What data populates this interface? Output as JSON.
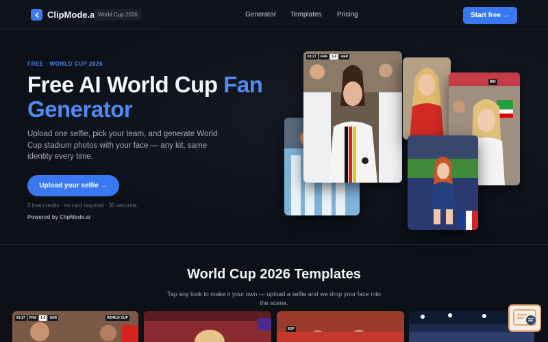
{
  "nav": {
    "brand": "ClipMode.ai",
    "badge": "World Cup 2026",
    "links": [
      "Generator",
      "Templates",
      "Pricing"
    ],
    "cta": "Start free →"
  },
  "hero": {
    "eyebrow": "FREE · WORLD CUP 2026",
    "title_part1": "Free AI World Cup ",
    "title_accent1": "Fan",
    "title_accent2": "Generator",
    "description": "Upload one selfie, pick your team, and generate World Cup stadium photos with your face — any kit, same identity every time.",
    "cta": "Upload your selfie →",
    "note": "3 free credits · no card required · 30 seconds",
    "powered": "Powered by ClipMode.ai"
  },
  "scoreboards": {
    "main": {
      "time": "63:27",
      "home": "FRA",
      "score": "1-0",
      "away": "GER"
    },
    "iran": {
      "team": "IRN"
    },
    "thumb1": {
      "time": "63:27",
      "home": "FRA",
      "score": "1-0",
      "away": "GER",
      "tag": "WORLD CUP"
    },
    "thumb3": {
      "team": "ESP"
    }
  },
  "templates": {
    "title": "World Cup 2026 Templates",
    "subtitle": "Tap any look to make it your own — upload a selfie and we drop your face into the scene."
  },
  "colors": {
    "accent": "#3a78f2",
    "background": "#0d1017"
  },
  "icons": {
    "logo": "chevron-left-icon",
    "chat": "support-chat-icon"
  }
}
